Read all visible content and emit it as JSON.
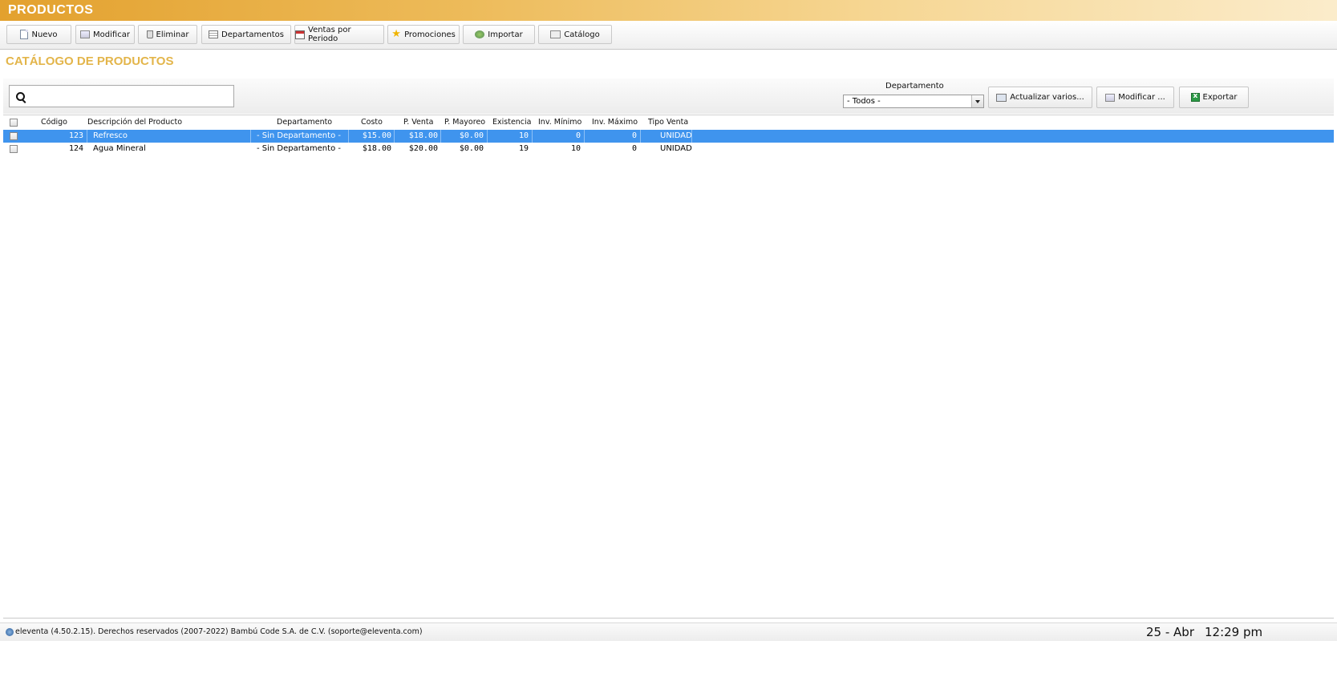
{
  "window": {
    "title": "PRODUCTOS"
  },
  "toolbar": {
    "buttons": [
      {
        "label": "Nuevo",
        "icon": "new-document-icon"
      },
      {
        "label": "Modificar",
        "icon": "edit-form-icon"
      },
      {
        "label": "Eliminar",
        "icon": "trash-icon"
      },
      {
        "label": "Departamentos",
        "icon": "departments-icon"
      },
      {
        "label": "Ventas por Periodo",
        "icon": "calendar-icon"
      },
      {
        "label": "Promociones",
        "icon": "star-icon"
      },
      {
        "label": "Importar",
        "icon": "import-icon"
      },
      {
        "label": "Catálogo",
        "icon": "catalog-icon"
      }
    ]
  },
  "page": {
    "heading": "CATÁLOGO DE PRODUCTOS"
  },
  "filters": {
    "search_value": "",
    "department_label": "Departamento",
    "department_selected": "- Todos -",
    "actions": [
      {
        "label": "Actualizar varios...",
        "icon": "monitor-icon"
      },
      {
        "label": "Modificar ...",
        "icon": "edit-form-icon"
      },
      {
        "label": "Exportar",
        "icon": "excel-icon"
      }
    ]
  },
  "table": {
    "columns": [
      "Código",
      "Descripción del Producto",
      "Departamento",
      "Costo",
      "P. Venta",
      "P. Mayoreo",
      "Existencia",
      "Inv. Mínimo",
      "Inv. Máximo",
      "Tipo Venta"
    ],
    "rows": [
      {
        "selected": true,
        "cells": [
          "123",
          "Refresco",
          "- Sin Departamento -",
          "$15.00",
          "$18.00",
          "$0.00",
          "10",
          "0",
          "0",
          "UNIDAD"
        ]
      },
      {
        "selected": false,
        "cells": [
          "124",
          "Agua Mineral",
          "- Sin Departamento -",
          "$18.00",
          "$20.00",
          "$0.00",
          "19",
          "10",
          "0",
          "UNIDAD"
        ]
      }
    ],
    "selection_color": "#3f94ee"
  },
  "status": {
    "text": "eleventa (4.50.2.15). Derechos reservados (2007-2022) Bambú Code S.A. de C.V. (soporte@eleventa.com)",
    "date": "25 - Abr",
    "time": "12:29 pm"
  },
  "colors": {
    "accent": "#e3a12e",
    "heading": "#e3b54a"
  }
}
